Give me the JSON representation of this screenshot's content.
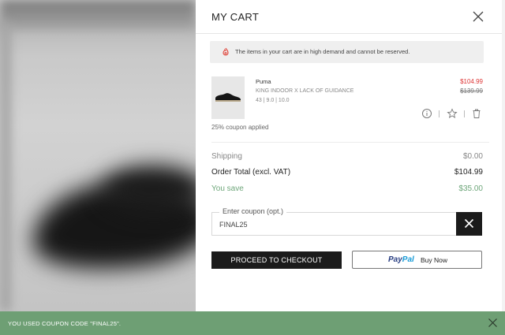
{
  "cart": {
    "title": "MY CART",
    "notice": "The items in your cart are in high demand and cannot be reserved.",
    "item": {
      "brand": "Puma",
      "name": "KING INDOOR X LACK OF GUIDANCE",
      "details": "43 | 9.0 | 10.0",
      "price_current": "$104.99",
      "price_original": "$139.99",
      "icons": [
        "info-icon",
        "star-icon",
        "trash-icon"
      ]
    },
    "coupon_note": "25% coupon applied",
    "summary": {
      "shipping_label": "Shipping",
      "shipping_value": "$0.00",
      "total_label": "Order Total (excl. VAT)",
      "total_value": "$104.99",
      "save_label": "You save",
      "save_value": "$35.00"
    },
    "coupon_field": {
      "label": "Enter coupon (opt.)",
      "value": "FINAL25"
    },
    "checkout_label": "PROCEED TO CHECKOUT",
    "paypal": {
      "pay": "Pay",
      "pal": "Pal",
      "suffix": "Buy Now"
    }
  },
  "toast": {
    "message": "YOU USED COUPON CODE \"FINAL25\"."
  },
  "colors": {
    "accent_dark": "#1b1b1b",
    "sale_red": "#dd3333",
    "save_green": "#6fa77b",
    "toast_bg": "#6e9f74",
    "paypal_dark": "#253b80",
    "paypal_light": "#179bd7"
  }
}
